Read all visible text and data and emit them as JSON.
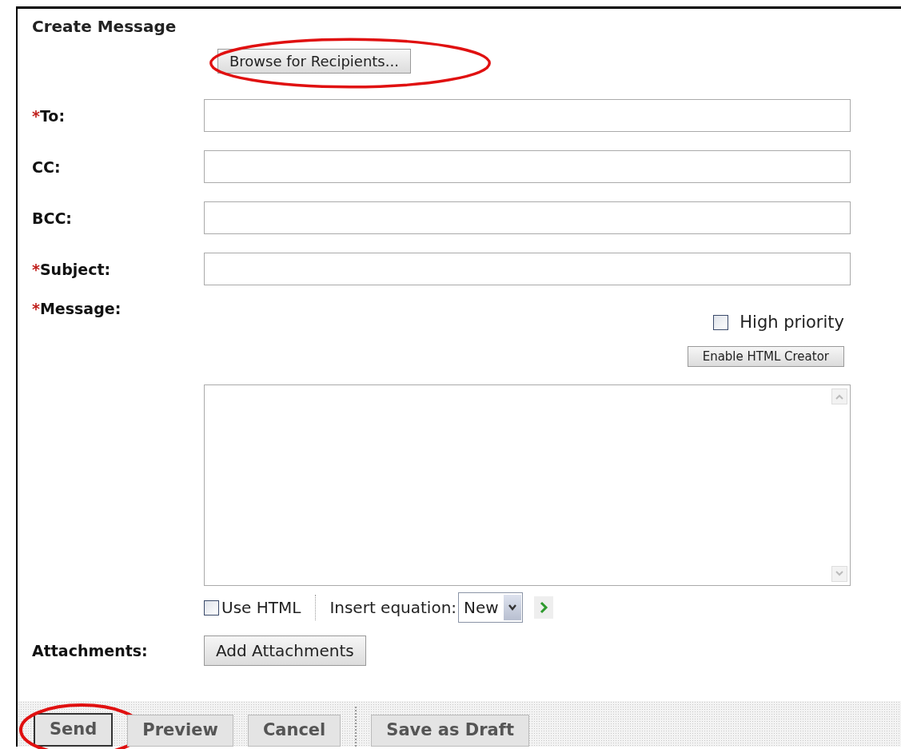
{
  "title": "Create Message",
  "browse_button": {
    "label": "Browse for Recipients...",
    "circled": true
  },
  "fields": [
    {
      "marker": "*",
      "label": "To:"
    },
    {
      "label": "CC:"
    },
    {
      "label": "BCC:"
    },
    {
      "marker": "*",
      "label": "Subject:"
    }
  ],
  "message": {
    "marker": "*",
    "label": "Message:"
  },
  "high_priority": {
    "label": "High priority",
    "checked": false
  },
  "enable_html_button": "Enable HTML Creator",
  "use_html": {
    "label": "Use HTML",
    "checked": false
  },
  "equation": {
    "label": "Insert equation:",
    "value": "New"
  },
  "attachments": {
    "label": "Attachments:",
    "button": "Add Attachments"
  },
  "actions": [
    {
      "label": "Send",
      "focused": true,
      "circled": true
    },
    {
      "label": "Preview",
      "focused": false,
      "circled": false
    },
    {
      "label": "Cancel",
      "focused": false,
      "circled": false
    },
    {
      "label": "Save as Draft",
      "focused": false,
      "circled": false
    }
  ]
}
